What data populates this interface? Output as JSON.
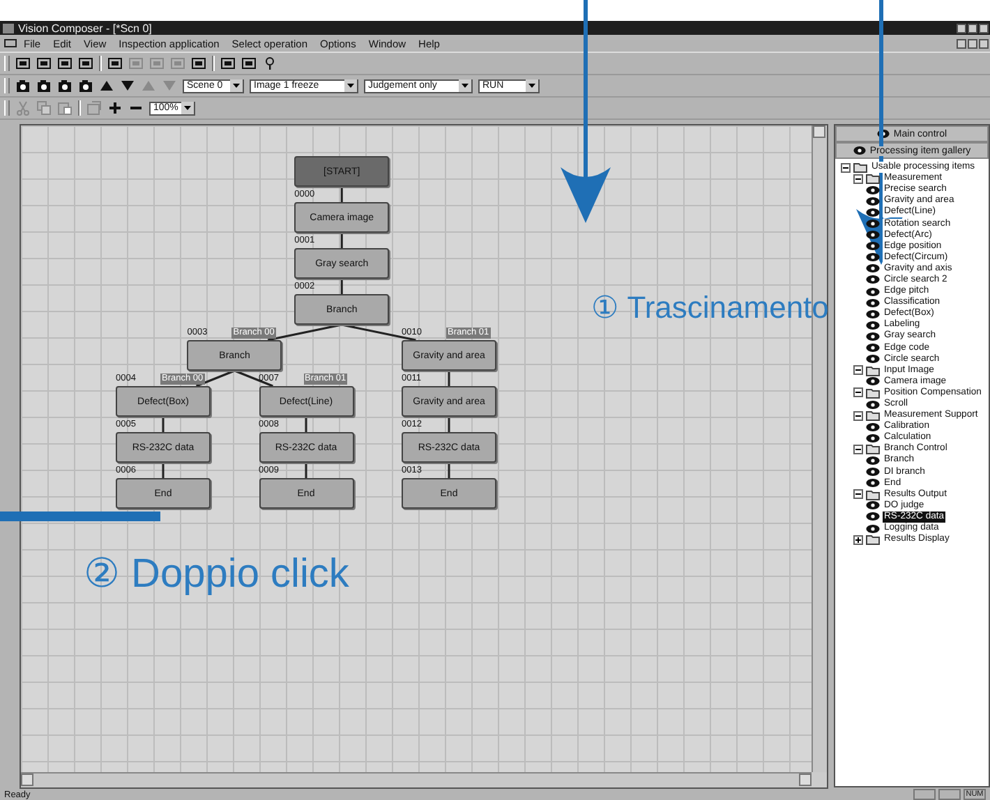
{
  "window": {
    "title": "Vision Composer - [*Scn 0]"
  },
  "menu": [
    {
      "label": "File"
    },
    {
      "label": "Edit"
    },
    {
      "label": "View"
    },
    {
      "label": "Inspection application"
    },
    {
      "label": "Select operation"
    },
    {
      "label": "Options"
    },
    {
      "label": "Window"
    },
    {
      "label": "Help"
    }
  ],
  "toolbar_1": [
    {
      "kind": "tool",
      "disabled": false
    },
    {
      "kind": "tool",
      "disabled": false
    },
    {
      "kind": "tool",
      "disabled": false
    },
    {
      "kind": "tool",
      "disabled": false
    },
    {
      "kind": "sep"
    },
    {
      "kind": "tool",
      "disabled": false
    },
    {
      "kind": "tool",
      "disabled": true
    },
    {
      "kind": "tool",
      "disabled": true
    },
    {
      "kind": "tool",
      "disabled": true
    },
    {
      "kind": "tool",
      "disabled": false
    },
    {
      "kind": "sep"
    },
    {
      "kind": "tool",
      "disabled": false
    },
    {
      "kind": "tool",
      "disabled": false
    },
    {
      "kind": "help",
      "disabled": false
    }
  ],
  "toolbar_2": {
    "icons": [
      {
        "kind": "camera",
        "disabled": false
      },
      {
        "kind": "camera",
        "disabled": false
      },
      {
        "kind": "camera",
        "disabled": false
      },
      {
        "kind": "camera",
        "disabled": false
      },
      {
        "kind": "up",
        "disabled": false
      },
      {
        "kind": "down",
        "disabled": false
      },
      {
        "kind": "up",
        "disabled": true
      },
      {
        "kind": "down",
        "disabled": true
      }
    ],
    "dropdowns": [
      {
        "value": "Scene 0",
        "kind": "short"
      },
      {
        "value": "Image 1 freeze",
        "kind": "long"
      },
      {
        "value": "Judgement only",
        "kind": "long"
      },
      {
        "value": "RUN",
        "kind": "short"
      }
    ]
  },
  "toolbar_3": {
    "icons": [
      {
        "kind": "cut",
        "disabled": true
      },
      {
        "kind": "copy",
        "disabled": true
      },
      {
        "kind": "paste",
        "disabled": true
      },
      {
        "kind": "sep"
      },
      {
        "kind": "properties",
        "disabled": true
      },
      {
        "kind": "plus",
        "disabled": false
      },
      {
        "kind": "minus",
        "disabled": false
      }
    ],
    "zoom": {
      "value": "100%"
    }
  },
  "flow": {
    "label": "[START]",
    "kind": "start",
    "children": [
      {
        "number": "0000",
        "label": "Camera image",
        "kind": "step",
        "children": [
          {
            "number": "0001",
            "label": "Gray search",
            "kind": "step",
            "children": [
              {
                "number": "0002",
                "label": "Branch",
                "kind": "step",
                "children": [
                  {
                    "number": "0003",
                    "branch_label": "Branch 00",
                    "label": "Branch",
                    "kind": "step",
                    "children": [
                      {
                        "number": "0004",
                        "branch_label": "Branch 00",
                        "label": "Defect(Box)",
                        "kind": "step",
                        "children": [
                          {
                            "number": "0005",
                            "label": "RS-232C data",
                            "kind": "step",
                            "children": [
                              {
                                "number": "0006",
                                "label": "End",
                                "kind": "step"
                              }
                            ]
                          }
                        ]
                      },
                      {
                        "number": "0007",
                        "branch_label": "Branch 01",
                        "label": "Defect(Line)",
                        "kind": "step",
                        "children": [
                          {
                            "number": "0008",
                            "label": "RS-232C data",
                            "kind": "step",
                            "children": [
                              {
                                "number": "0009",
                                "label": "End",
                                "kind": "step"
                              }
                            ]
                          }
                        ]
                      }
                    ]
                  },
                  {
                    "number": "0010",
                    "branch_label": "Branch 01",
                    "label": "Gravity and area",
                    "kind": "step",
                    "children": [
                      {
                        "number": "0011",
                        "label": "Gravity and area",
                        "kind": "step",
                        "children": [
                          {
                            "number": "0012",
                            "label": "RS-232C data",
                            "kind": "step",
                            "children": [
                              {
                                "number": "0013",
                                "label": "End",
                                "kind": "step"
                              }
                            ]
                          }
                        ]
                      }
                    ]
                  }
                ]
              }
            ]
          }
        ]
      }
    ]
  },
  "panel": {
    "buttons": [
      {
        "label": "Main control"
      },
      {
        "label": "Processing item gallery"
      }
    ],
    "tree": [
      {
        "label": "Usable processing items",
        "expanded": true,
        "selected": false,
        "children": [
          {
            "label": "Measurement",
            "expanded": true,
            "selected": false,
            "children": [
              {
                "label": "Precise search",
                "selected": false
              },
              {
                "label": "Gravity and area",
                "selected": false
              },
              {
                "label": "Defect(Line)",
                "selected": false
              },
              {
                "label": "Rotation search",
                "selected": false
              },
              {
                "label": "Defect(Arc)",
                "selected": false
              },
              {
                "label": "Edge position",
                "selected": false
              },
              {
                "label": "Defect(Circum)",
                "selected": false
              },
              {
                "label": "Gravity and axis",
                "selected": false
              },
              {
                "label": "Circle search 2",
                "selected": false
              },
              {
                "label": "Edge pitch",
                "selected": false
              },
              {
                "label": "Classification",
                "selected": false
              },
              {
                "label": "Defect(Box)",
                "selected": false
              },
              {
                "label": "Labeling",
                "selected": false
              },
              {
                "label": "Gray search",
                "selected": false
              },
              {
                "label": "Edge code",
                "selected": false
              },
              {
                "label": "Circle search",
                "selected": false
              }
            ]
          },
          {
            "label": "Input Image",
            "expanded": true,
            "selected": false,
            "children": [
              {
                "label": "Camera image",
                "selected": false
              }
            ]
          },
          {
            "label": "Position Compensation",
            "expanded": true,
            "selected": false,
            "children": [
              {
                "label": "Scroll",
                "selected": false
              }
            ]
          },
          {
            "label": "Measurement Support",
            "expanded": true,
            "selected": false,
            "children": [
              {
                "label": "Calibration",
                "selected": false
              },
              {
                "label": "Calculation",
                "selected": false
              }
            ]
          },
          {
            "label": "Branch Control",
            "expanded": true,
            "selected": false,
            "children": [
              {
                "label": "Branch",
                "selected": false
              },
              {
                "label": "DI branch",
                "selected": false
              },
              {
                "label": "End",
                "selected": false
              }
            ]
          },
          {
            "label": "Results Output",
            "expanded": true,
            "selected": false,
            "children": [
              {
                "label": "DO judge",
                "selected": false
              },
              {
                "label": "RS-232C data",
                "selected": true
              },
              {
                "label": "Logging data",
                "selected": false
              }
            ]
          },
          {
            "label": "Results Display",
            "expanded": false,
            "selected": false
          }
        ]
      }
    ]
  },
  "status_bar": {
    "message": "Ready",
    "indicator": "NUM"
  },
  "annotations": [
    {
      "kind": "arrow"
    },
    {
      "kind": "arrow"
    },
    {
      "kind": "bar"
    },
    {
      "kind": "caption",
      "text": "① Trascinamento"
    },
    {
      "kind": "caption",
      "text": "② Doppio click"
    }
  ]
}
